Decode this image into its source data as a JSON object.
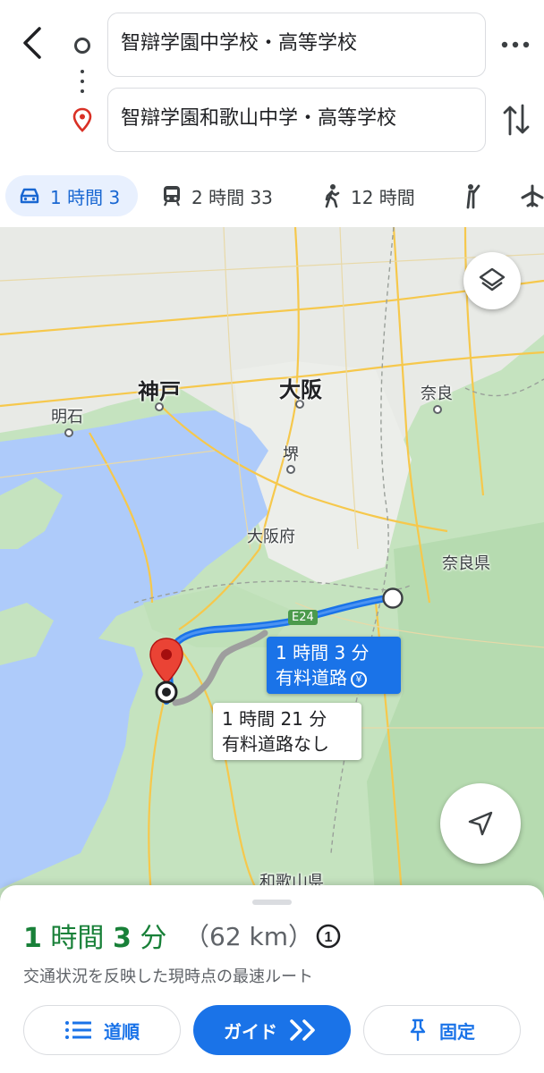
{
  "header": {
    "origin": "智辯学園中学校・高等学校",
    "destination": "智辯学園和歌山中学・高等学校"
  },
  "modes": {
    "car": "1 時間 3",
    "transit": "2 時間 33",
    "walk": "12 時間"
  },
  "map": {
    "labels": {
      "kobe": "神戸",
      "osaka": "大阪",
      "nara": "奈良",
      "akashi": "明石",
      "sakai": "堺",
      "osaka_pref": "大阪府",
      "nara_pref": "奈良県",
      "wakayama_pref": "和歌山県"
    },
    "road": "E24",
    "callout_main": {
      "time": "1 時間 3 分",
      "note": "有料道路"
    },
    "callout_alt": {
      "time": "1 時間 21 分",
      "note": "有料道路なし"
    },
    "colors": {
      "route": "#1a73e8",
      "alt_route": "#9e9e9e",
      "pin": "#ea4335"
    }
  },
  "sheet": {
    "hours": "1",
    "hours_unit": " 時間 ",
    "minutes": "3",
    "minutes_unit": " 分",
    "distance": "（62 km）",
    "subtitle": "交通状況を反映した現時点の最速ルート",
    "steps_label": "道順",
    "guide_label": "ガイド",
    "pin_label": "固定"
  }
}
